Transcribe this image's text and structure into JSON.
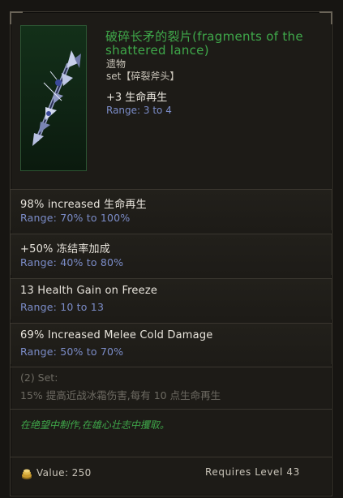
{
  "item": {
    "name": "破碎长矛的裂片(fragments of the shattered lance)",
    "type": "遗物",
    "set": "set【碎裂斧头】",
    "implicit": {
      "mod": "+3 生命再生",
      "range": "Range: 3 to 4"
    }
  },
  "affixes": [
    {
      "mod": "98% increased 生命再生",
      "range": "Range: 70% to 100%"
    },
    {
      "mod": "+50% 冻结率加成",
      "range": "Range: 40% to 80%"
    },
    {
      "mod": "13 Health Gain on Freeze",
      "range": "Range: 10 to 13"
    },
    {
      "mod": "69% Increased Melee Cold Damage",
      "range": "Range: 50% to 70%"
    }
  ],
  "set_bonus": {
    "label": "(2) Set:",
    "desc": "15% 提高近战冰霜伤害,每有 10 点生命再生"
  },
  "lore": "在绝望中制作,在雄心壮志中攫取。",
  "footer": {
    "value": "Value: 250",
    "requires": "Requires Level 43"
  },
  "colors": {
    "unique_name": "#3fa84a",
    "range": "#7b8cc8",
    "text": "#e8e4dc",
    "muted": "#6d6a62"
  }
}
